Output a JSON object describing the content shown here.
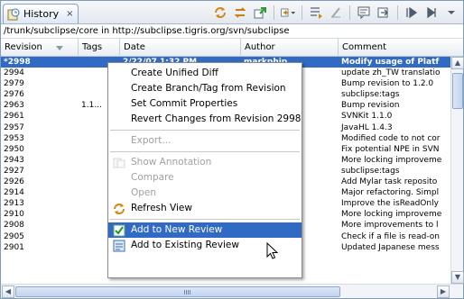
{
  "window": {
    "tab_title": "History",
    "tab_icon": "history-icon",
    "tab_close": "×",
    "toolbar_icons": [
      "sync-icon",
      "refresh-history-icon",
      "export-icon",
      "filter-icon",
      "compare-icon",
      "clear-icon",
      "comment-icon",
      "link-icon",
      "play-icon",
      "stop-icon",
      "view-menu-icon"
    ],
    "path": "/trunk/subclipse/core in http://subclipse.tigris.org/svn/subclipse"
  },
  "table": {
    "columns": [
      "Revision",
      "Tags",
      "Date",
      "Author",
      "Comment"
    ],
    "rows": [
      {
        "rev": "*2998",
        "tags": "",
        "date": "2/22/07 1:32 PM",
        "author": "markphip",
        "comment": "Modify usage of Platf",
        "selected": true
      },
      {
        "rev": "2994",
        "tags": "",
        "date": "",
        "author": "",
        "comment": "update zh_TW translatio"
      },
      {
        "rev": "2979",
        "tags": "",
        "date": "",
        "author": "",
        "comment": "Bump revision to 1.2.0"
      },
      {
        "rev": "2976",
        "tags": "",
        "date": "",
        "author": "",
        "comment": "subclipse:tags"
      },
      {
        "rev": "2963",
        "tags": "1.1...",
        "date": "",
        "author": "",
        "comment": "Bump revision"
      },
      {
        "rev": "2961",
        "tags": "",
        "date": "",
        "author": "",
        "comment": "SVNKit 1.1.0"
      },
      {
        "rev": "2957",
        "tags": "",
        "date": "",
        "author": "",
        "comment": "JavaHL 1.4.3"
      },
      {
        "rev": "2953",
        "tags": "",
        "date": "",
        "author": "",
        "comment": "Modified code to not cor"
      },
      {
        "rev": "2950",
        "tags": "",
        "date": "",
        "author": "",
        "comment": "Fix potential NPE in SVN"
      },
      {
        "rev": "2943",
        "tags": "",
        "date": "",
        "author": "",
        "comment": "More locking improveme"
      },
      {
        "rev": "2927",
        "tags": "",
        "date": "",
        "author": "",
        "comment": "subclipse:tags"
      },
      {
        "rev": "2926",
        "tags": "",
        "date": "",
        "author": "",
        "comment": "Add Mylar task reposito"
      },
      {
        "rev": "2914",
        "tags": "",
        "date": "",
        "author": "",
        "comment": "Major refactoring.  Simpl"
      },
      {
        "rev": "2913",
        "tags": "",
        "date": "",
        "author": "",
        "comment": "Improve the isReadOnly"
      },
      {
        "rev": "2910",
        "tags": "",
        "date": "",
        "author": "",
        "comment": "More locking improveme"
      },
      {
        "rev": "2908",
        "tags": "",
        "date": "",
        "author": "",
        "comment": "More improvements to l"
      },
      {
        "rev": "2905",
        "tags": "",
        "date": "",
        "author": "",
        "comment": "Check if a file is read-on"
      },
      {
        "rev": "2901",
        "tags": "",
        "date": "12/00/06 12:00 AM",
        "author": "rjurko",
        "comment": "Updated Japanese mess"
      }
    ]
  },
  "context_menu": {
    "items": [
      {
        "label": "Create Unified Diff",
        "enabled": true,
        "icon": ""
      },
      {
        "label": "Create Branch/Tag from Revision",
        "enabled": true,
        "icon": ""
      },
      {
        "label": "Set Commit Properties",
        "enabled": true,
        "icon": ""
      },
      {
        "label": "Revert Changes from Revision 2998",
        "enabled": true,
        "icon": ""
      },
      {
        "sep": true
      },
      {
        "label": "Export...",
        "enabled": false,
        "icon": ""
      },
      {
        "sep": true
      },
      {
        "label": "Show Annotation",
        "enabled": false,
        "icon": "annotation-icon"
      },
      {
        "label": "Compare",
        "enabled": false,
        "icon": ""
      },
      {
        "label": "Open",
        "enabled": false,
        "icon": ""
      },
      {
        "label": "Refresh View",
        "enabled": true,
        "icon": "refresh-icon"
      },
      {
        "sep": true
      },
      {
        "label": "Add to New Review",
        "enabled": true,
        "icon": "review-check-icon",
        "highlighted": true
      },
      {
        "label": "Add to Existing Review",
        "enabled": true,
        "icon": "existing-review-icon"
      }
    ]
  },
  "colors": {
    "selection": "#316ac5",
    "border": "#7f9db9"
  }
}
